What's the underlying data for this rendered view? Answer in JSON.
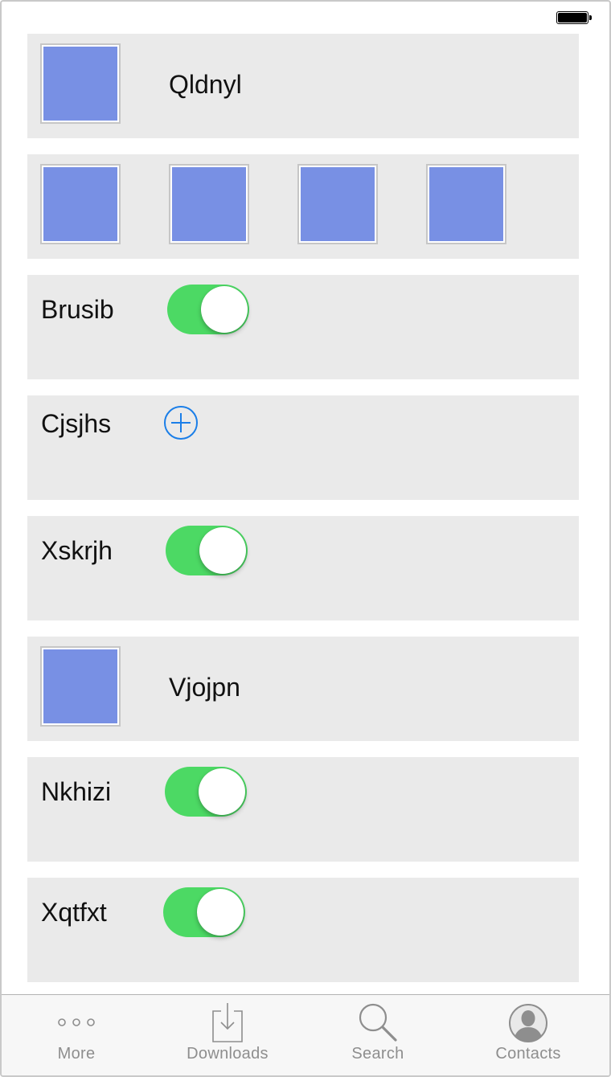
{
  "status_bar": {
    "battery_icon": "battery-full-icon"
  },
  "rows": [
    {
      "type": "image-label",
      "label": "Qldnyl"
    },
    {
      "type": "image-strip",
      "count": 4
    },
    {
      "type": "toggle",
      "label": "Brusib",
      "on": true
    },
    {
      "type": "add",
      "label": "Cjsjhs",
      "icon": "add-circle-icon"
    },
    {
      "type": "toggle",
      "label": "Xskrjh",
      "on": true
    },
    {
      "type": "image-label",
      "label": "Vjojpn"
    },
    {
      "type": "toggle",
      "label": "Nkhizi",
      "on": true
    },
    {
      "type": "toggle",
      "label": "Xqtfxt",
      "on": true
    }
  ],
  "tab_bar": {
    "tabs": [
      {
        "label": "More",
        "icon": "more-icon"
      },
      {
        "label": "Downloads",
        "icon": "downloads-icon"
      },
      {
        "label": "Search",
        "icon": "search-icon"
      },
      {
        "label": "Contacts",
        "icon": "contacts-icon"
      }
    ]
  },
  "colors": {
    "cell_background": "#eaeaea",
    "image_placeholder": "#7890e4",
    "toggle_on": "#4cd964",
    "add_button": "#1a7ee8",
    "tab_inactive": "#8e8e8e"
  }
}
